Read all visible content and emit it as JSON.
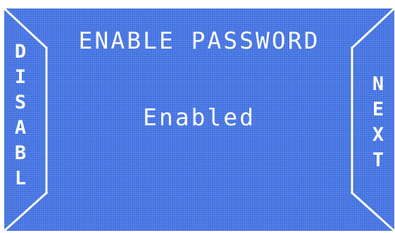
{
  "screen": {
    "title": "ENABLE PASSWORD",
    "status": "Enabled"
  },
  "buttons": {
    "disable_label": "DISABL",
    "next_label": "NEXT"
  },
  "colors": {
    "background": "#3f6fe0",
    "foreground": "#ffffff"
  }
}
